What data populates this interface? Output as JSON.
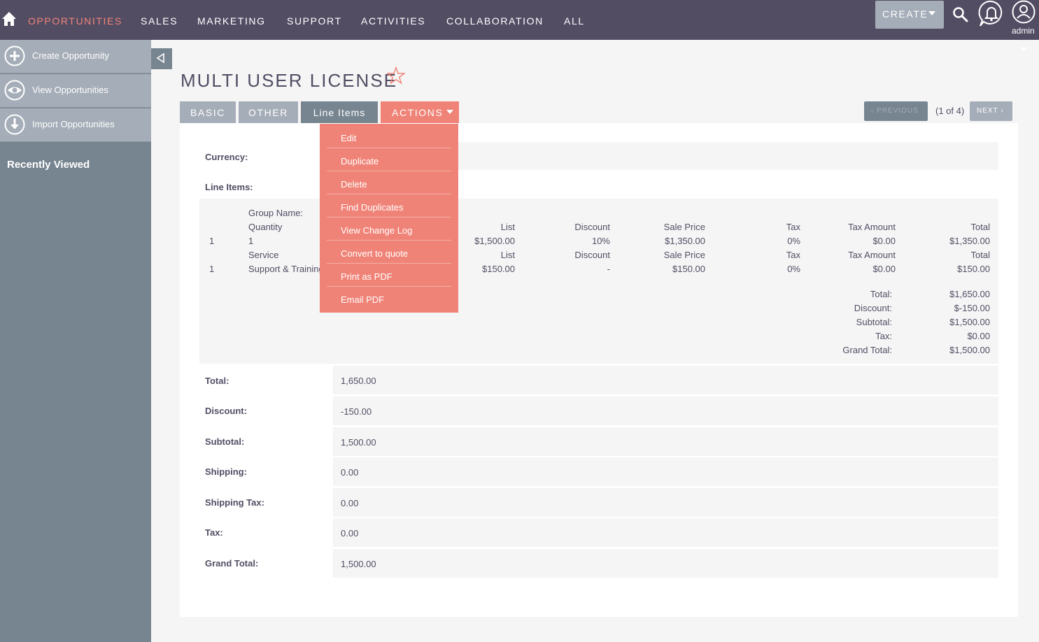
{
  "nav": {
    "items": [
      "OPPORTUNITIES",
      "SALES",
      "MARKETING",
      "SUPPORT",
      "ACTIVITIES",
      "COLLABORATION",
      "ALL"
    ],
    "create_label": "CREATE",
    "user_label": "admin"
  },
  "sidebar": {
    "actions": [
      "Create Opportunity",
      "View Opportunities",
      "Import Opportunities"
    ],
    "recently_viewed": "Recently Viewed"
  },
  "record": {
    "title": "MULTI USER LICENSE"
  },
  "tabs": {
    "basic": "BASIC",
    "other": "OTHER",
    "line_items": "Line Items",
    "actions": "ACTIONS"
  },
  "pager": {
    "previous": "PREVIOUS",
    "count": "(1 of 4)",
    "next": "NEXT"
  },
  "actions_menu": [
    "Edit",
    "Duplicate",
    "Delete",
    "Find Duplicates",
    "View Change Log",
    "Convert to quote",
    "Print as PDF",
    "Email PDF"
  ],
  "fields": {
    "currency_label": "Currency:",
    "line_items_label": "Line Items:"
  },
  "line_items": {
    "group_name_label": "Group Name:",
    "product_row": {
      "qty_header": "Quantity",
      "list_header": "List",
      "discount_header": "Discount",
      "sale_header": "Sale Price",
      "tax_header": "Tax",
      "tax_amount_header": "Tax Amount",
      "total_header": "Total",
      "index": "1",
      "qty": "1",
      "list": "$1,500.00",
      "discount": "10%",
      "sale": "$1,350.00",
      "tax": "0%",
      "tax_amount": "$0.00",
      "total": "$1,350.00"
    },
    "service_row": {
      "service_header": "Service",
      "list_header": "List",
      "discount_header": "Discount",
      "sale_header": "Sale Price",
      "tax_header": "Tax",
      "tax_amount_header": "Tax Amount",
      "total_header": "Total",
      "index": "1",
      "name": "Support & Training",
      "list": "$150.00",
      "discount": "-",
      "sale": "$150.00",
      "tax": "0%",
      "tax_amount": "$0.00",
      "total": "$150.00"
    },
    "summary": [
      {
        "label": "Total:",
        "value": "$1,650.00"
      },
      {
        "label": "Discount:",
        "value": "$-150.00"
      },
      {
        "label": "Subtotal:",
        "value": "$1,500.00"
      },
      {
        "label": "Tax:",
        "value": "$0.00"
      },
      {
        "label": "Grand Total:",
        "value": "$1,500.00"
      }
    ]
  },
  "totals": [
    {
      "label": "Total:",
      "value": "1,650.00"
    },
    {
      "label": "Discount:",
      "value": "-150.00"
    },
    {
      "label": "Subtotal:",
      "value": "1,500.00"
    },
    {
      "label": "Shipping:",
      "value": "0.00"
    },
    {
      "label": "Shipping Tax:",
      "value": "0.00"
    },
    {
      "label": "Tax:",
      "value": "0.00"
    },
    {
      "label": "Grand Total:",
      "value": "1,500.00"
    }
  ],
  "colors": {
    "nav_bg": "#534d64",
    "accent": "#f08377",
    "sidebar_bg": "#778591",
    "tab_bg": "#a5adb8"
  }
}
